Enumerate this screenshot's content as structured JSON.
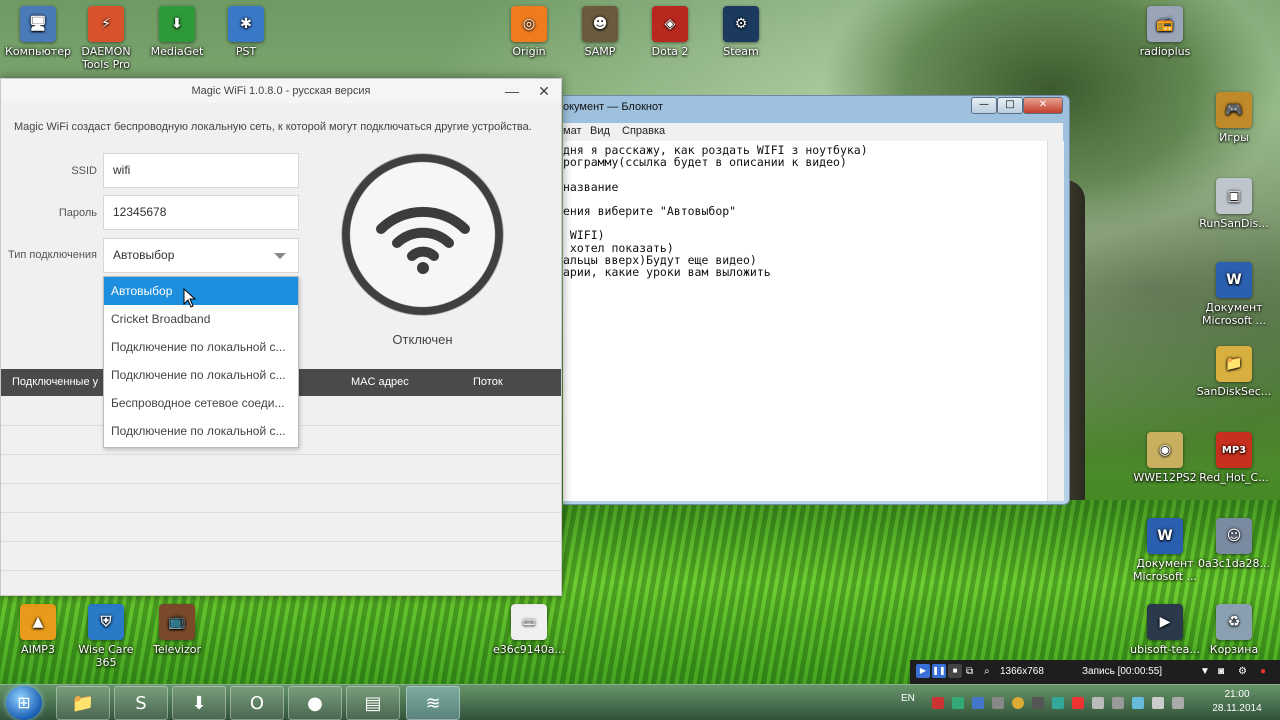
{
  "desktop": {
    "icons": [
      {
        "label": "Компьютер",
        "icon": "computer-icon",
        "glyph": "🖥",
        "color": "#4a7ab8"
      },
      {
        "label": "DAEMON Tools Pro",
        "icon": "daemon-tools-icon",
        "glyph": "⚡",
        "color": "#d8532b"
      },
      {
        "label": "MediaGet",
        "icon": "mediaget-icon",
        "glyph": "⬇",
        "color": "#2e9a3a"
      },
      {
        "label": "PST",
        "icon": "pst-icon",
        "glyph": "✱",
        "color": "#3a78c8"
      },
      {
        "label": "Origin",
        "icon": "origin-icon",
        "glyph": "◎",
        "color": "#f07b1e"
      },
      {
        "label": "SAMP",
        "icon": "samp-icon",
        "glyph": "☻",
        "color": "#6b5a3c"
      },
      {
        "label": "Dota 2",
        "icon": "dota2-icon",
        "glyph": "◈",
        "color": "#b8281e"
      },
      {
        "label": "Steam",
        "icon": "steam-icon",
        "glyph": "⚙",
        "color": "#1b3a5e"
      },
      {
        "label": "radioplus",
        "icon": "radioplus-icon",
        "glyph": "📻",
        "color": "#9aa6b8"
      },
      {
        "label": "Игры",
        "icon": "games-folder-icon",
        "glyph": "🎮",
        "color": "#c08a2a"
      },
      {
        "label": "RunSanDis...",
        "icon": "runsandisk-icon",
        "glyph": "▣",
        "color": "#bfc5cc"
      },
      {
        "label": "Документ Microsoft ...",
        "icon": "word-document-icon",
        "glyph": "W",
        "color": "#2b5fb0"
      },
      {
        "label": "SanDiskSec...",
        "icon": "sandisk-folder-icon",
        "glyph": "📁",
        "color": "#d8b040"
      },
      {
        "label": "WWE12PS2",
        "icon": "disc-icon",
        "glyph": "◉",
        "color": "#c8b060"
      },
      {
        "label": "Red_Hot_C...",
        "icon": "mp3-icon",
        "glyph": "MP3",
        "color": "#c8301e"
      },
      {
        "label": "Документ Microsoft ...",
        "icon": "word-document-icon",
        "glyph": "W",
        "color": "#2b5fb0"
      },
      {
        "label": "0a3c1da28...",
        "icon": "image-file-icon",
        "glyph": "☺",
        "color": "#7a8aa0"
      },
      {
        "label": "ubisoft-tea...",
        "icon": "ubisoft-icon",
        "glyph": "▶",
        "color": "#2a3a4a"
      },
      {
        "label": "Корзина",
        "icon": "recycle-bin-icon",
        "glyph": "♻",
        "color": "#8aa0b0"
      },
      {
        "label": "AIMP3",
        "icon": "aimp-icon",
        "glyph": "▲",
        "color": "#e89a1a"
      },
      {
        "label": "Wise Care 365",
        "icon": "wise-care-icon",
        "glyph": "⛨",
        "color": "#2a7ac8"
      },
      {
        "label": "Televizor",
        "icon": "tv-icon",
        "glyph": "📺",
        "color": "#7a4a2a"
      },
      {
        "label": "e36c9140a...",
        "icon": "image-file-icon",
        "glyph": "▭",
        "color": "#f0f0f0"
      }
    ]
  },
  "magic_wifi": {
    "title": "Magic WiFi 1.0.8.0 - русская версия",
    "minimize": "—",
    "close": "✕",
    "description": "Magic WiFi создаст беспроводную локальную сеть, к которой могут подключаться другие устройства.",
    "ssid_label": "SSID",
    "ssid_value": "wifi",
    "password_label": "Пароль",
    "password_value": "12345678",
    "connection_label": "Тип подключения",
    "connection_value": "Автовыбор",
    "dropdown_options": [
      "Автовыбор",
      "Cricket Broadband",
      "Подключение по локальной с...",
      "Подключение по локальной с...",
      "Беспроводное сетевое соеди...",
      "Подключение по локальной с..."
    ],
    "selected_option_index": 0,
    "status": "Отключен",
    "table_headers": {
      "devices": "Подключенные у",
      "mac": "MAC адрес",
      "flow": "Поток"
    }
  },
  "notepad": {
    "title": "окумент — Блокнот",
    "controls": {
      "minimize": "—",
      "maximize": "□",
      "close": "✕"
    },
    "menu": [
      "мат",
      "Вид",
      "Справка"
    ],
    "lines": [
      "дня я расскажу, как роздать WIFI з ноутбука)",
      "рограмму(ссылка будет в описании к видео)",
      "",
      "название",
      "",
      "ения виберите \"Автовыбор\"",
      "",
      " WIFI)",
      " хотел показать)",
      "альцы вверх)Будут еще видео)",
      "арии, какие уроки вам выложить"
    ]
  },
  "recorder": {
    "resolution": "1366x768",
    "status": "Запись [00:00:55]"
  },
  "taskbar": {
    "buttons": [
      {
        "icon": "explorer-icon",
        "glyph": "📁"
      },
      {
        "icon": "skype-icon",
        "glyph": "S"
      },
      {
        "icon": "downloader-icon",
        "glyph": "⬇"
      },
      {
        "icon": "opera-icon",
        "glyph": "O"
      },
      {
        "icon": "recorder-icon",
        "glyph": "●"
      },
      {
        "icon": "notepad-icon",
        "glyph": "▤"
      },
      {
        "icon": "magic-wifi-icon",
        "glyph": "≋"
      }
    ],
    "language": "EN",
    "time": "21:00",
    "date": "28.11.2014"
  },
  "colors": {
    "accent": "#1e8ede",
    "table_header": "#4a4a4a"
  }
}
